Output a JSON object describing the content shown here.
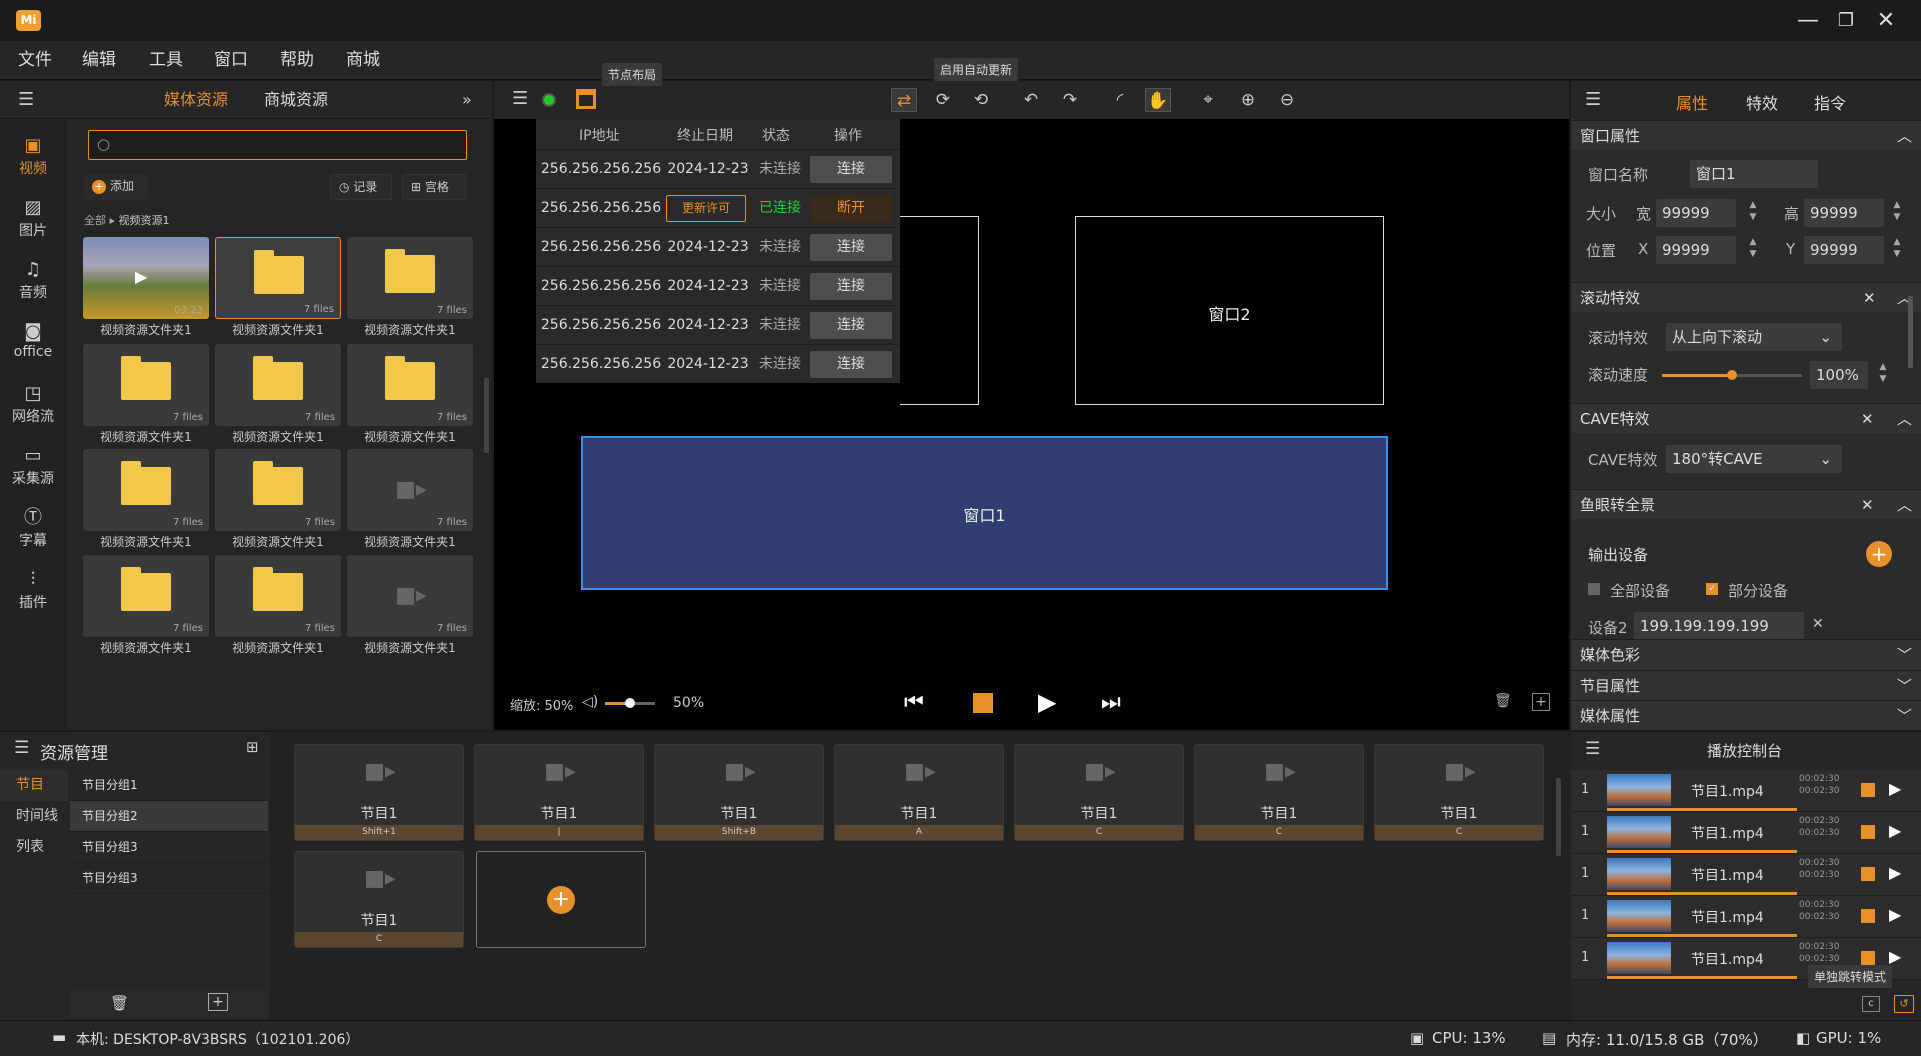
{
  "app": {
    "logo": "Mi"
  },
  "menu": [
    "文件",
    "编辑",
    "工具",
    "窗口",
    "帮助",
    "商城"
  ],
  "left": {
    "tabs": [
      "媒体资源",
      "商城资源"
    ],
    "nav": [
      "视频",
      "图片",
      "音频",
      "office",
      "网络流",
      "采集源",
      "字幕",
      "插件"
    ],
    "add": "添加",
    "record": "记录",
    "grid": "宫格",
    "breadcrumb_root": "全部",
    "breadcrumb_current": "视频资源1",
    "tiles": [
      {
        "cap": "视频资源文件夹1",
        "files": "03:23",
        "type": "video"
      },
      {
        "cap": "视频资源文件夹1",
        "files": "7 files",
        "type": "folder"
      },
      {
        "cap": "视频资源文件夹1",
        "files": "7 files",
        "type": "folder"
      },
      {
        "cap": "视频资源文件夹1",
        "files": "7 files",
        "type": "folder"
      },
      {
        "cap": "视频资源文件夹1",
        "files": "7 files",
        "type": "folder"
      },
      {
        "cap": "视频资源文件夹1",
        "files": "7 files",
        "type": "folder"
      },
      {
        "cap": "视频资源文件夹1",
        "files": "7 files",
        "type": "folder"
      },
      {
        "cap": "视频资源文件夹1",
        "files": "7 files",
        "type": "folder"
      },
      {
        "cap": "视频资源文件夹1",
        "files": "7 files",
        "type": "cam"
      },
      {
        "cap": "视频资源文件夹1",
        "files": "7 files",
        "type": "folder"
      },
      {
        "cap": "视频资源文件夹1",
        "files": "7 files",
        "type": "folder"
      },
      {
        "cap": "视频资源文件夹1",
        "files": "7 files",
        "type": "cam"
      }
    ]
  },
  "center": {
    "tooltip_layout": "节点布局",
    "tooltip_update": "启用自动更新",
    "table_headers": [
      "IP地址",
      "终止日期",
      "状态",
      "操作"
    ],
    "rows": [
      {
        "ip": "256.256.256.256",
        "date": "2024-12-23",
        "status": "未连接",
        "action": "连接"
      },
      {
        "ip": "256.256.256.256",
        "date": "更新许可",
        "status": "已连接",
        "action": "断开"
      },
      {
        "ip": "256.256.256.256",
        "date": "2024-12-23",
        "status": "未连接",
        "action": "连接"
      },
      {
        "ip": "256.256.256.256",
        "date": "2024-12-23",
        "status": "未连接",
        "action": "连接"
      },
      {
        "ip": "256.256.256.256",
        "date": "2024-12-23",
        "status": "未连接",
        "action": "连接"
      },
      {
        "ip": "256.256.256.256",
        "date": "2024-12-23",
        "status": "未连接",
        "action": "连接"
      }
    ],
    "win1": "窗口1",
    "win2": "窗口2",
    "zoom": "缩放: 50%",
    "volume": "50%",
    "volume_level": 0.5
  },
  "right": {
    "tabs": [
      "属性",
      "特效",
      "指令"
    ],
    "win_props": "窗口属性",
    "win_name_label": "窗口名称",
    "win_name": "窗口1",
    "size_label": "大小",
    "w_label": "宽",
    "w": "99999",
    "h_label": "高",
    "h": "99999",
    "pos_label": "位置",
    "x_label": "X",
    "x": "99999",
    "y_label": "Y",
    "y": "99999",
    "scroll_fx": "滚动特效",
    "scroll_fx_label": "滚动特效",
    "scroll_fx_value": "从上向下滚动",
    "scroll_speed_label": "滚动速度",
    "scroll_speed": "100%",
    "scroll_speed_level": 0.5,
    "cave": "CAVE特效",
    "cave_label": "CAVE特效",
    "cave_value": "180°转CAVE",
    "fisheye": "鱼眼转全景",
    "output": "输出设备",
    "all_dev": "全部设备",
    "part_dev": "部分设备",
    "dev_label": "设备2",
    "dev_ip": "199.199.199.199",
    "media_color": "媒体色彩",
    "prog_props": "节目属性",
    "media_props": "媒体属性"
  },
  "bottom": {
    "title": "资源管理",
    "nav": [
      "节目",
      "时间线",
      "列表"
    ],
    "groups": [
      "节目分组1",
      "节目分组2",
      "节目分组3",
      "节目分组3"
    ],
    "programs": [
      {
        "name": "节目1",
        "key": "Shift+1"
      },
      {
        "name": "节目1",
        "key": "|"
      },
      {
        "name": "节目1",
        "key": "Shift+B"
      },
      {
        "name": "节目1",
        "key": "A"
      },
      {
        "name": "节目1",
        "key": "C"
      },
      {
        "name": "节目1",
        "key": "C"
      },
      {
        "name": "节目1",
        "key": "C"
      },
      {
        "name": "节目1",
        "key": "C"
      }
    ],
    "console_title": "播放控制台",
    "console_rows": [
      {
        "idx": "1",
        "name": "节目1.mp4",
        "t1": "00:02:30",
        "t2": "00:02:30",
        "progress": 0.95
      },
      {
        "idx": "1",
        "name": "节目1.mp4",
        "t1": "00:02:30",
        "t2": "00:02:30",
        "progress": 0.95
      },
      {
        "idx": "1",
        "name": "节目1.mp4",
        "t1": "00:02:30",
        "t2": "00:02:30",
        "progress": 0.95
      },
      {
        "idx": "1",
        "name": "节目1.mp4",
        "t1": "00:02:30",
        "t2": "00:02:30",
        "progress": 0.95
      },
      {
        "idx": "1",
        "name": "节目1.mp4",
        "t1": "00:02:30",
        "t2": "00:02:30",
        "progress": 0.95
      }
    ],
    "console_tooltip": "单独跳转模式"
  },
  "status": {
    "host": "本机: DESKTOP-8V3BSRS（102101.206）",
    "cpu": "CPU: 13%",
    "mem": "内存: 11.0/15.8 GB（70%）",
    "gpu": "GPU: 1%"
  }
}
